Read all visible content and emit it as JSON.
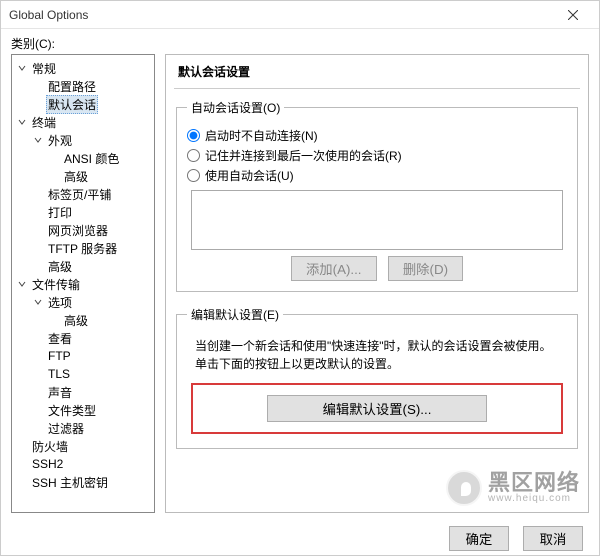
{
  "window": {
    "title": "Global Options"
  },
  "catLabel": "类别(C):",
  "tree": {
    "n0": "常规",
    "n0a": "配置路径",
    "n0b": "默认会话",
    "n1": "终端",
    "n1a": "外观",
    "n1a1": "ANSI 颜色",
    "n1a2": "高级",
    "n1b": "标签页/平铺",
    "n1c": "打印",
    "n1d": "网页浏览器",
    "n1e": "TFTP 服务器",
    "n1f": "高级",
    "n2": "文件传输",
    "n2a": "选项",
    "n2a1": "高级",
    "n2b": "查看",
    "n2c": "FTP",
    "n2d": "TLS",
    "n2e": "声音",
    "n2f": "文件类型",
    "n2g": "过滤器",
    "n3": "防火墙",
    "n4": "SSH2",
    "n5": "SSH 主机密钥"
  },
  "pane": {
    "header": "默认会话设置",
    "autoLegend": "自动会话设置(O)",
    "r1": "启动时不自动连接(N)",
    "r2": "记住并连接到最后一次使用的会话(R)",
    "r3": "使用自动会话(U)",
    "addBtn": "添加(A)...",
    "delBtn": "删除(D)",
    "editLegend": "编辑默认设置(E)",
    "hint1": "当创建一个新会话和使用\"快速连接\"时，默认的会话设置会被使用。",
    "hint2": "单击下面的按钮上以更改默认的设置。",
    "editBtn": "编辑默认设置(S)..."
  },
  "footer": {
    "ok": "确定",
    "cancel": "取消"
  },
  "watermark": {
    "main": "黑区网络",
    "sub": "www.heiqu.com"
  }
}
